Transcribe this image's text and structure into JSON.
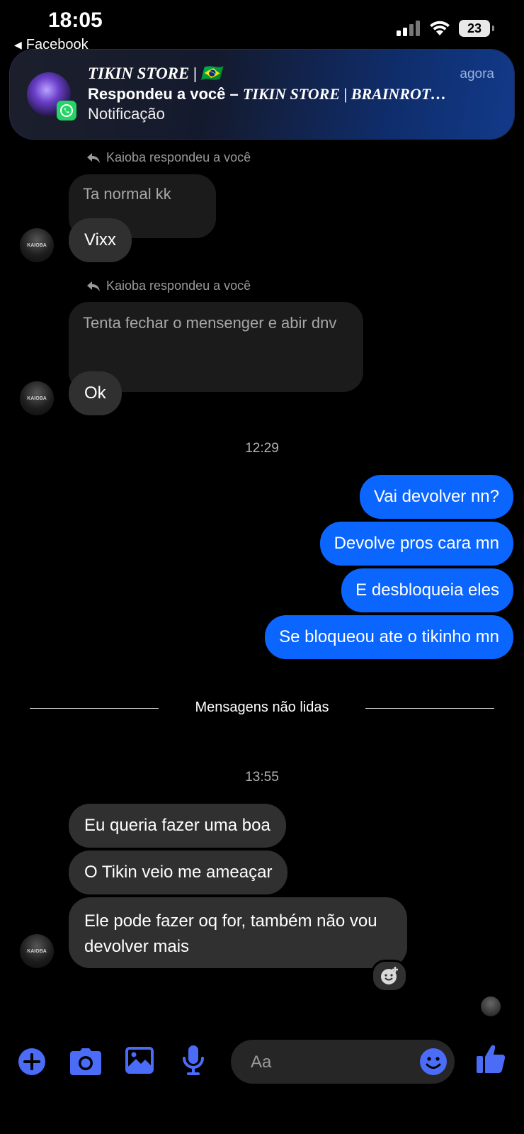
{
  "status_bar": {
    "time": "18:05",
    "back_app": "Facebook",
    "battery": "23"
  },
  "notification": {
    "title": "TIKIN  STORE | 🇧🇷",
    "time": "agora",
    "line2_prefix": "Respondeu a você – ",
    "line2_name": "TIKIN  STORE | BRAINROT…",
    "line3": "Notificação",
    "app_icon": "whatsapp-icon"
  },
  "thread": {
    "reply_group_1": {
      "label": "Kaioba respondeu a você",
      "quoted": "Ta normal kk",
      "reply": "Vixx"
    },
    "reply_group_2": {
      "label": "Kaioba respondeu a você",
      "quoted": "Tenta fechar o mensenger e abir dnv",
      "reply": "Ok"
    },
    "timestamp_1": "12:29",
    "outgoing": [
      "Vai devolver nn?",
      "Devolve pros cara mn",
      "E desbloqueia eles",
      "Se bloqueou ate o tikinho mn"
    ],
    "unread_divider": "Mensagens não lidas",
    "timestamp_2": "13:55",
    "incoming": [
      "Eu queria fazer uma boa",
      "O Tikin veio me ameaçar",
      "Ele pode fazer oq for, também não vou devolver mais"
    ],
    "avatar_text": "KAIOBA"
  },
  "composer": {
    "placeholder": "Aa",
    "icons": [
      "plus-icon",
      "camera-icon",
      "gallery-icon",
      "microphone-icon",
      "emoji-icon",
      "thumbs-up-icon"
    ]
  },
  "colors": {
    "accent": "#0a66ff",
    "icon_blue": "#4a6cf7",
    "incoming_bubble": "#303030",
    "background": "#000000"
  }
}
